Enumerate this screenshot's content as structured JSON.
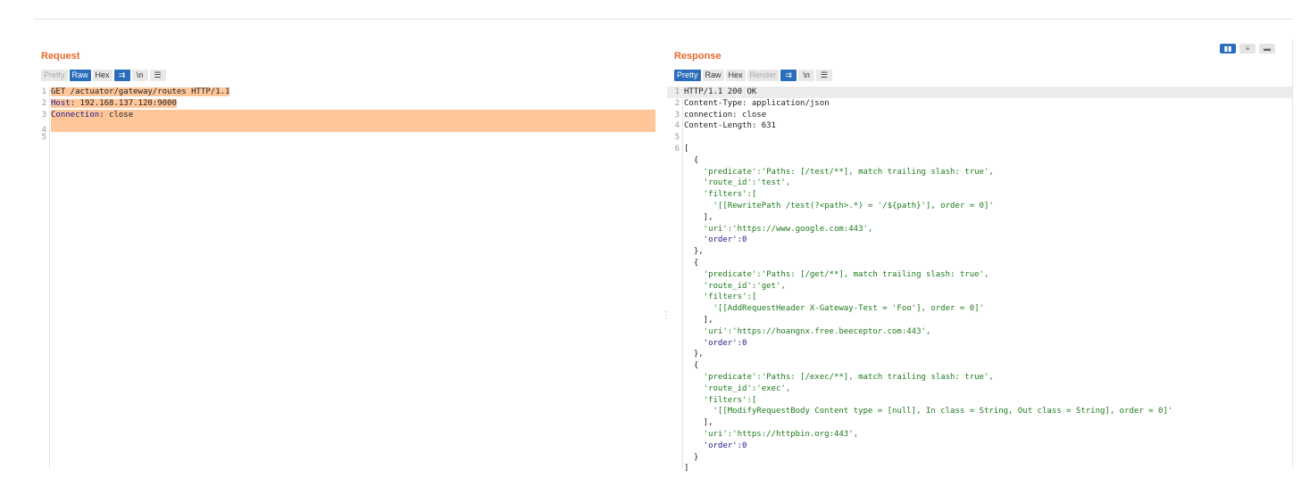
{
  "view_switch": {
    "options": [
      "side-by-side",
      "horizontal",
      "vertical"
    ]
  },
  "request": {
    "title": "Request",
    "toolbar": [
      "Pretty",
      "Raw",
      "Hex"
    ],
    "selected": "Raw",
    "newline_label": "\\n",
    "lines": [
      {
        "num": "1",
        "text": "GET /actuator/gateway/routes HTTP/1.1"
      },
      {
        "num": "2",
        "key": "Host",
        "val": ": 192.168.137.120:9000"
      },
      {
        "num": "3",
        "key": "Connection",
        "val": ": close"
      },
      {
        "num": "4",
        "text": ""
      },
      {
        "num": "5",
        "text": ""
      }
    ]
  },
  "response": {
    "title": "Response",
    "toolbar": [
      "Pretty",
      "Raw",
      "Hex",
      "Render"
    ],
    "selected": "Pretty",
    "newline_label": "\\n",
    "lines": [
      {
        "num": "1",
        "text": "HTTP/1.1 200 OK"
      },
      {
        "num": "2",
        "text": "Content-Type: application/json"
      },
      {
        "num": "3",
        "text": "connection: close"
      },
      {
        "num": "4",
        "text": "Content-Length: 631"
      },
      {
        "num": "5",
        "text": ""
      },
      {
        "num": "6",
        "text": "["
      },
      {
        "text": "  {"
      },
      {
        "text": "    'predicate':'Paths: [/test/**], match trailing slash: true',"
      },
      {
        "text": "    'route_id':'test',"
      },
      {
        "text": "    'filters':["
      },
      {
        "text": "      '[[RewritePath /test(?<path>.*) = '/${path}'], order = 0]'"
      },
      {
        "text": "    ],"
      },
      {
        "text": "    'uri':'https://www.google.com:443',"
      },
      {
        "text": "    'order':0"
      },
      {
        "text": "  },"
      },
      {
        "text": "  {"
      },
      {
        "text": "    'predicate':'Paths: [/get/**], match trailing slash: true',"
      },
      {
        "text": "    'route_id':'get',"
      },
      {
        "text": "    'filters':["
      },
      {
        "text": "      '[[AddRequestHeader X-Gateway-Test = 'Foo'], order = 0]'"
      },
      {
        "text": "    ],"
      },
      {
        "text": "    'uri':'https://hoangnx.free.beeceptor.com:443',"
      },
      {
        "text": "    'order':0"
      },
      {
        "text": "  },"
      },
      {
        "text": "  {"
      },
      {
        "text": "    'predicate':'Paths: [/exec/**], match trailing slash: true',"
      },
      {
        "text": "    'route_id':'exec',"
      },
      {
        "text": "    'filters':["
      },
      {
        "text": "      '[[ModifyRequestBody Content type = [null], In class = String, Out class = String], order = 0]'"
      },
      {
        "text": "    ],"
      },
      {
        "text": "    'uri':'https://httpbin.org:443',"
      },
      {
        "text": "    'order':0"
      },
      {
        "text": "  }"
      },
      {
        "text": "]"
      }
    ]
  },
  "colors": {
    "accent": "#e8692c",
    "selected": "#2a6ebb",
    "highlight": "#ffc69a"
  }
}
